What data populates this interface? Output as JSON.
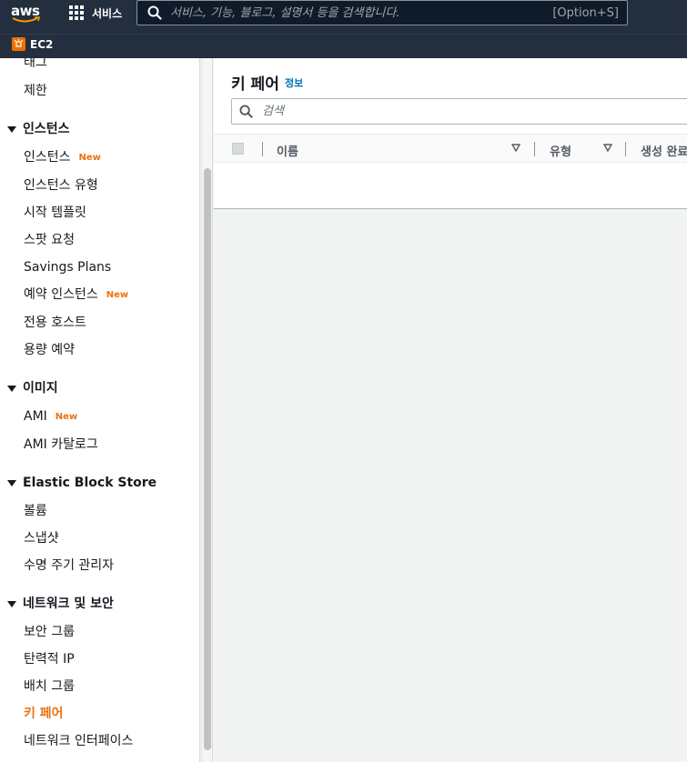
{
  "topnav": {
    "logo_text": "aws",
    "services_label": "서비스",
    "search_placeholder": "서비스, 기능, 블로그, 설명서 등을 검색합니다.",
    "search_shortcut": "[Option+S]"
  },
  "servicebar": {
    "service_name": "EC2",
    "accent_color": "#ed7100"
  },
  "sidebar": {
    "new_badge": "New",
    "tag_link": "태그",
    "limits_link": "제한",
    "instances_section": {
      "title": "인스턴스",
      "items": [
        "인스턴스",
        "인스턴스 유형",
        "시작 템플릿",
        "스팟 요청",
        "Savings Plans",
        "예약 인스턴스",
        "전용 호스트",
        "용량 예약"
      ]
    },
    "images_section": {
      "title": "이미지",
      "items": [
        "AMI",
        "AMI 카탈로그"
      ]
    },
    "ebs_section": {
      "title": "Elastic Block Store",
      "items": [
        "볼륨",
        "스냅샷",
        "수명 주기 관리자"
      ]
    },
    "network_section": {
      "title": "네트워크 및 보안",
      "items": [
        "보안 그룹",
        "탄력적 IP",
        "배치 그룹",
        "키 페어",
        "네트워크 인터페이스"
      ],
      "active_item": "키 페어"
    }
  },
  "main": {
    "title": "키 페어",
    "info_link": "정보",
    "filter_placeholder": "검색",
    "columns": [
      "이름",
      "유형",
      "생성 완료"
    ]
  }
}
